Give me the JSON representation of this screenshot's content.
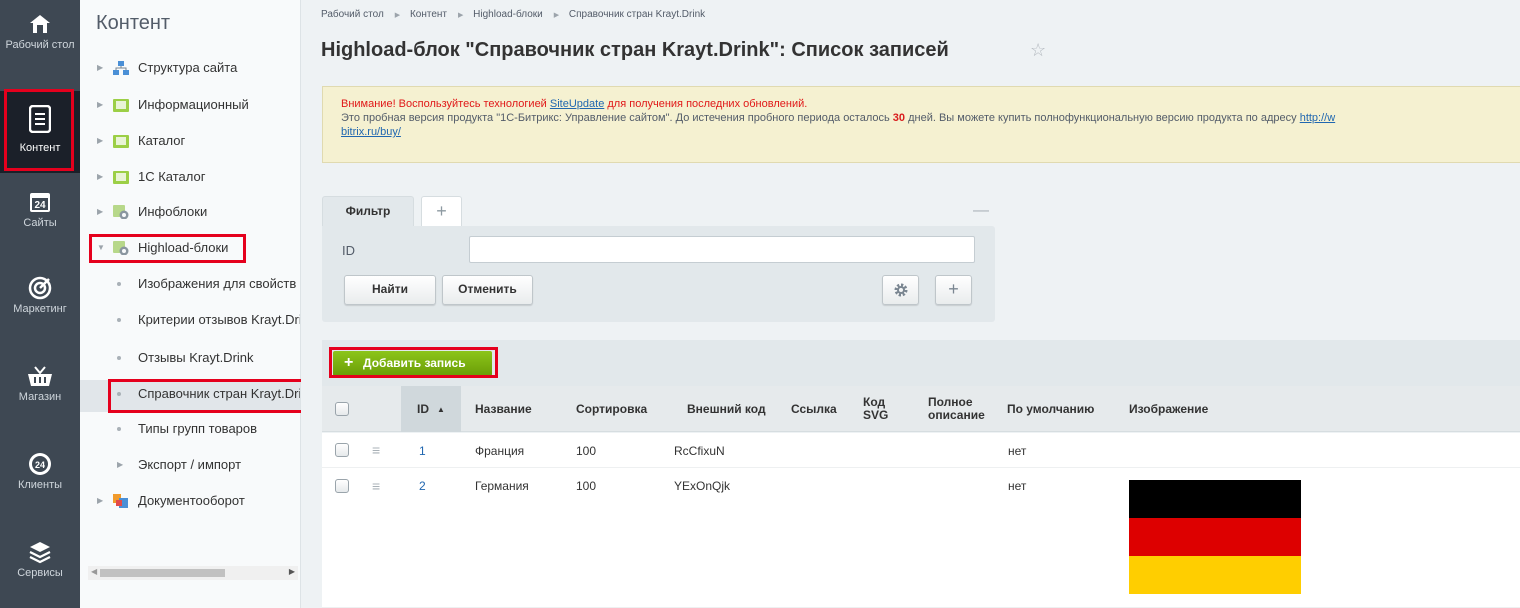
{
  "left_panel": {
    "items": [
      {
        "icon": "home-icon",
        "label": "Рабочий стол"
      },
      {
        "icon": "document-icon",
        "label": "Контент",
        "active": true
      },
      {
        "icon": "calendar-24-icon",
        "label": "Сайты"
      },
      {
        "icon": "target-icon",
        "label": "Маркетинг"
      },
      {
        "icon": "basket-icon",
        "label": "Магазин"
      },
      {
        "icon": "clients-24-icon",
        "label": "Клиенты"
      },
      {
        "icon": "layers-icon",
        "label": "Сервисы"
      }
    ]
  },
  "tree": {
    "title": "Контент",
    "items": [
      {
        "label": "Структура сайта",
        "icon": "structure-icon",
        "arrow": "▶"
      },
      {
        "label": "Информационный",
        "icon": "folder-icon",
        "arrow": "▶"
      },
      {
        "label": "Каталог",
        "icon": "folder-icon",
        "arrow": "▶"
      },
      {
        "label": "1С Каталог",
        "icon": "folder-icon",
        "arrow": "▶"
      },
      {
        "label": "Инфоблоки",
        "icon": "iblock-icon",
        "arrow": "▶"
      },
      {
        "label": "Highload-блоки",
        "icon": "iblock-icon",
        "arrow": "▼"
      },
      {
        "label": "Изображения для свойств",
        "sub": true
      },
      {
        "label": "Критерии отзывов Krayt.Drink",
        "sub": true
      },
      {
        "label": "Отзывы Krayt.Drink",
        "sub": true
      },
      {
        "label": "Справочник стран Krayt.Drink",
        "sub": true,
        "selected": true
      },
      {
        "label": "Типы групп товаров",
        "sub": true
      },
      {
        "label": "Экспорт / импорт",
        "sub": true,
        "arrow": "▶"
      },
      {
        "label": "Документооборот",
        "icon": "docflow-icon",
        "arrow": "▶"
      }
    ]
  },
  "breadcrumbs": [
    "Рабочий стол",
    "Контент",
    "Highload-блоки",
    "Справочник стран Krayt.Drink"
  ],
  "page_title": "Highload-блок \"Справочник стран Krayt.Drink\": Список записей",
  "notice": {
    "warning_prefix": "Внимание! Воспользуйтесь технологией ",
    "warning_link": "SiteUpdate",
    "warning_suffix": " для получения последних обновлений.",
    "line2_prefix": "Это пробная версия продукта \"1С-Битрикс: Управление сайтом\". До истечения пробного периода осталось ",
    "days": "30",
    "line2_suffix": " дней. Вы можете купить полнофункциональную версию продукта по адресу ",
    "url_start": "http://w",
    "url_end": "bitrix.ru/buy/"
  },
  "filter": {
    "tab_label": "Фильтр",
    "add_tab": "+",
    "minimize": "—",
    "field_label": "ID",
    "field_value": "",
    "find_button": "Найти",
    "cancel_button": "Отменить",
    "add_field": "+"
  },
  "toolbar": {
    "add_button": "Добавить запись"
  },
  "grid": {
    "columns": [
      "ID",
      "Название",
      "Сортировка",
      "Внешний код",
      "Ссылка",
      "Код SVG",
      "Полное описание",
      "По умолчанию",
      "Изображение"
    ],
    "sort_arrow": "▲",
    "rows": [
      {
        "id": "1",
        "name": "Франция",
        "sort": "100",
        "xml_id": "RcCfixuN",
        "link": "",
        "svg": "",
        "desc": "",
        "default": "нет",
        "image": ""
      },
      {
        "id": "2",
        "name": "Германия",
        "sort": "100",
        "xml_id": "YExOnQjk",
        "link": "",
        "svg": "",
        "desc": "",
        "default": "нет",
        "image": "flag-germany",
        "flag_colors": [
          "#000000",
          "#dd0000",
          "#ffce00"
        ]
      }
    ]
  },
  "colors": {
    "sidebar": "#3e4853",
    "accent_green": "#7bb40f",
    "highlight_red": "#e5001d",
    "link": "#2067b0"
  }
}
